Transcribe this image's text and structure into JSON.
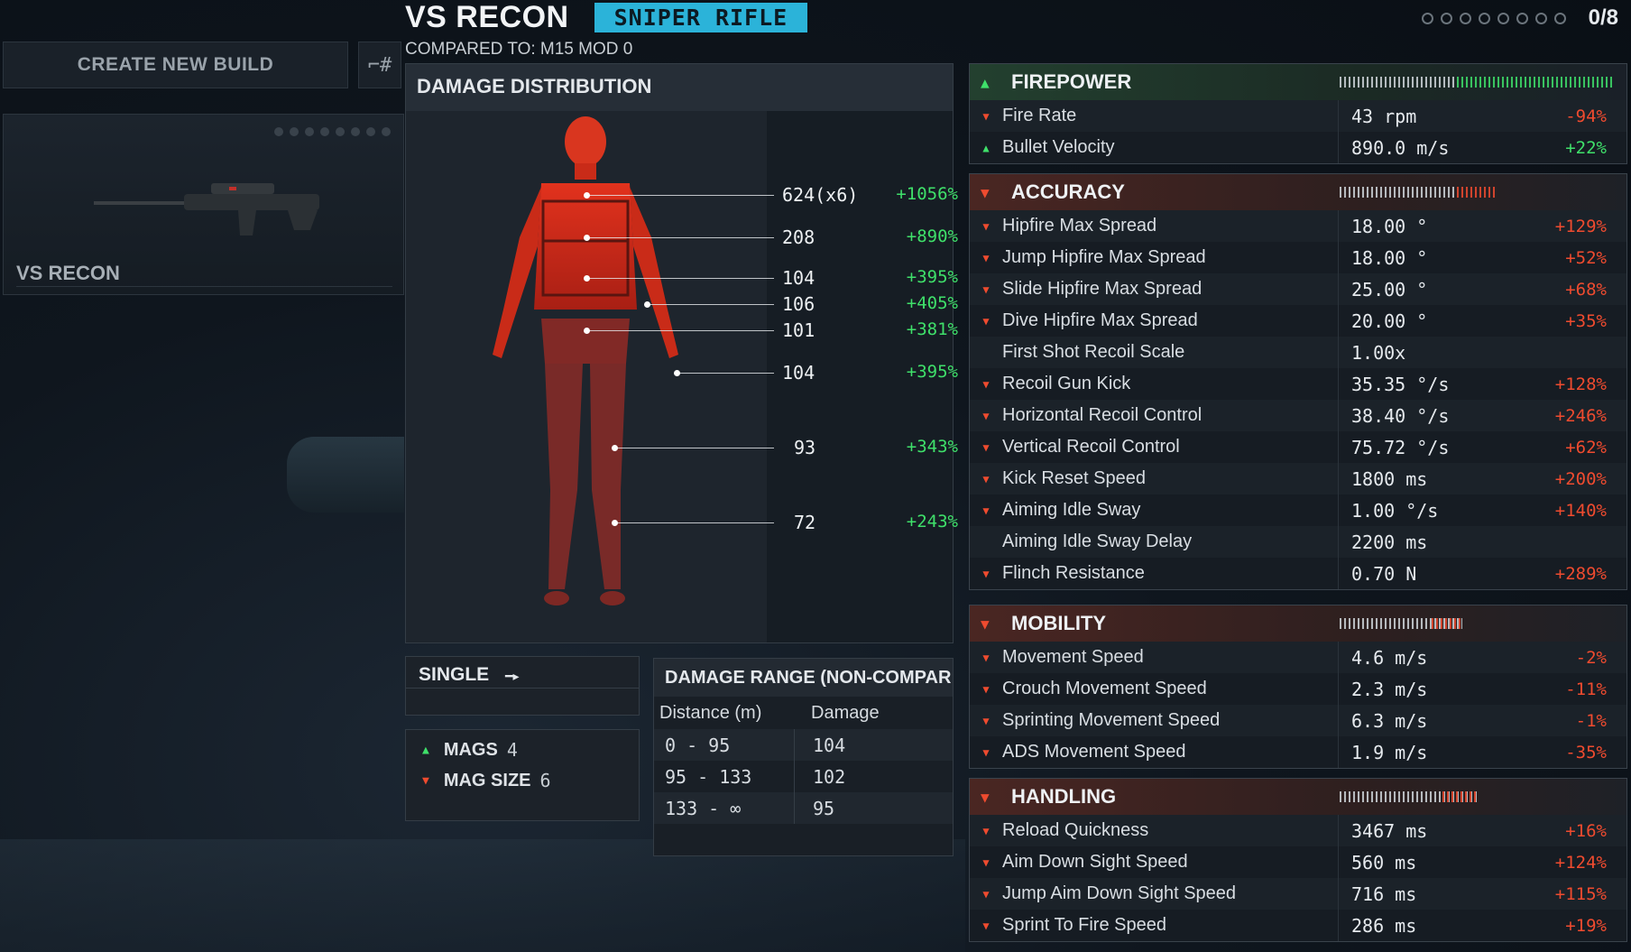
{
  "header": {
    "title": "VS RECON",
    "weapon_class": "SNIPER RIFLE",
    "compared_to": "COMPARED TO: M15 MOD 0",
    "progress": "0/8"
  },
  "sidebar": {
    "create_build": "CREATE NEW BUILD",
    "loadout_name": "VS RECON"
  },
  "damage_distribution": {
    "title": "DAMAGE DISTRIBUTION",
    "zones": [
      {
        "value": "624(x6)",
        "delta": "+1056%"
      },
      {
        "value": "208",
        "delta": "+890%"
      },
      {
        "value": "104",
        "delta": "+395%"
      },
      {
        "value": "106",
        "delta": "+405%"
      },
      {
        "value": "101",
        "delta": "+381%"
      },
      {
        "value": "104",
        "delta": "+395%"
      },
      {
        "value": "93",
        "delta": "+343%"
      },
      {
        "value": "72",
        "delta": "+243%"
      }
    ]
  },
  "fire_mode": {
    "label": "SINGLE"
  },
  "mags": {
    "mags_label": "MAGS",
    "mags_value": "4",
    "mag_size_label": "MAG SIZE",
    "mag_size_value": "6"
  },
  "damage_range": {
    "title": "DAMAGE RANGE  (NON-COMPAR",
    "col_distance": "Distance (m)",
    "col_damage": "Damage",
    "rows": [
      {
        "distance": "0 - 95",
        "damage": "104"
      },
      {
        "distance": "95 - 133",
        "damage": "102"
      },
      {
        "distance": "133 - ∞",
        "damage": "95"
      }
    ]
  },
  "colors": {
    "up": "#3fe06a",
    "down": "#ef4b2f",
    "badge": "#2bb3d9"
  },
  "sections": [
    {
      "title": "FIREPOWER",
      "trend": "up",
      "bar_level": 0.43,
      "stats": [
        {
          "name": "Fire Rate",
          "value": "43 rpm",
          "delta": "-94%",
          "trend": "down"
        },
        {
          "name": "Bullet Velocity",
          "value": "890.0 m/s",
          "delta": "+22%",
          "trend": "up"
        }
      ]
    },
    {
      "title": "ACCURACY",
      "trend": "down",
      "bar_level": 0.57,
      "stats": [
        {
          "name": "Hipfire Max Spread",
          "value": "18.00 °",
          "delta": "+129%",
          "trend": "down"
        },
        {
          "name": "Jump Hipfire Max Spread",
          "value": "18.00 °",
          "delta": "+52%",
          "trend": "down"
        },
        {
          "name": "Slide Hipfire Max Spread",
          "value": "25.00 °",
          "delta": "+68%",
          "trend": "down"
        },
        {
          "name": "Dive Hipfire Max Spread",
          "value": "20.00 °",
          "delta": "+35%",
          "trend": "down"
        },
        {
          "name": "First Shot Recoil Scale",
          "value": "1.00x",
          "delta": "",
          "trend": "none"
        },
        {
          "name": "Recoil Gun Kick",
          "value": "35.35 °/s",
          "delta": "+128%",
          "trend": "down"
        },
        {
          "name": "Horizontal Recoil Control",
          "value": "38.40 °/s",
          "delta": "+246%",
          "trend": "down"
        },
        {
          "name": "Vertical Recoil Control",
          "value": "75.72 °/s",
          "delta": "+62%",
          "trend": "down"
        },
        {
          "name": "Kick Reset Speed",
          "value": "1800 ms",
          "delta": "+200%",
          "trend": "down"
        },
        {
          "name": "Aiming Idle Sway",
          "value": "1.00 °/s",
          "delta": "+140%",
          "trend": "down"
        },
        {
          "name": "Aiming Idle Sway Delay",
          "value": "2200 ms",
          "delta": "",
          "trend": "none"
        },
        {
          "name": "Flinch Resistance",
          "value": "0.70 N",
          "delta": "+289%",
          "trend": "down"
        }
      ]
    },
    {
      "title": "MOBILITY",
      "trend": "down",
      "bar_level": 0.45,
      "stats": [
        {
          "name": "Movement Speed",
          "value": "4.6 m/s",
          "delta": "-2%",
          "trend": "down"
        },
        {
          "name": "Crouch Movement Speed",
          "value": "2.3 m/s",
          "delta": "-11%",
          "trend": "down"
        },
        {
          "name": "Sprinting Movement Speed",
          "value": "6.3 m/s",
          "delta": "-1%",
          "trend": "down"
        },
        {
          "name": "ADS Movement Speed",
          "value": "1.9 m/s",
          "delta": "-35%",
          "trend": "down"
        }
      ]
    },
    {
      "title": "HANDLING",
      "trend": "down",
      "bar_level": 0.5,
      "stats": [
        {
          "name": "Reload Quickness",
          "value": "3467 ms",
          "delta": "+16%",
          "trend": "down"
        },
        {
          "name": "Aim Down Sight Speed",
          "value": "560 ms",
          "delta": "+124%",
          "trend": "down"
        },
        {
          "name": "Jump Aim Down Sight Speed",
          "value": "716 ms",
          "delta": "+115%",
          "trend": "down"
        },
        {
          "name": "Sprint To Fire Speed",
          "value": "286 ms",
          "delta": "+19%",
          "trend": "down"
        }
      ]
    }
  ]
}
